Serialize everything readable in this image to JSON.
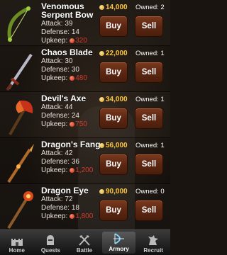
{
  "items": [
    {
      "name": "Venomous Serpent Bow",
      "attack_label": "Attack:",
      "attack": "39",
      "defense_label": "Defense:",
      "defense": "14",
      "upkeep_label": "Upkeep:",
      "upkeep": "320",
      "price": "14,000",
      "owned": "Owned: 2",
      "icon": "serpent-bow-icon"
    },
    {
      "name": "Chaos Blade",
      "attack_label": "Attack:",
      "attack": "30",
      "defense_label": "Defense:",
      "defense": "30",
      "upkeep_label": "Upkeep:",
      "upkeep": "480",
      "price": "22,000",
      "owned": "Owned: 1",
      "icon": "sword-icon"
    },
    {
      "name": "Devil's Axe",
      "attack_label": "Attack:",
      "attack": "44",
      "defense_label": "Defense:",
      "defense": "24",
      "upkeep_label": "Upkeep:",
      "upkeep": "750",
      "price": "34,000",
      "owned": "Owned: 1",
      "icon": "axe-icon"
    },
    {
      "name": "Dragon's Fang",
      "attack_label": "Attack:",
      "attack": "42",
      "defense_label": "Defense:",
      "defense": "36",
      "upkeep_label": "Upkeep:",
      "upkeep": "1,200",
      "price": "56,000",
      "owned": "Owned: 1",
      "icon": "spear-icon"
    },
    {
      "name": "Dragon Eye",
      "attack_label": "Attack:",
      "attack": "72",
      "defense_label": "Defense:",
      "defense": "18",
      "upkeep_label": "Upkeep:",
      "upkeep": "1,800",
      "price": "90,000",
      "owned": "Owned: 0",
      "icon": "staff-icon"
    }
  ],
  "buttons": {
    "buy": "Buy",
    "sell": "Sell"
  },
  "tabs": [
    {
      "label": "Home",
      "icon": "castle-icon"
    },
    {
      "label": "Quests",
      "icon": "knight-helmet-icon"
    },
    {
      "label": "Battle",
      "icon": "crossed-axes-icon"
    },
    {
      "label": "Armory",
      "icon": "bow-icon",
      "active": true
    },
    {
      "label": "Recruit",
      "icon": "griffin-icon"
    }
  ],
  "colors": {
    "price": "#ffc640",
    "upkeep": "#d43a2a",
    "button": "#5c2712"
  }
}
